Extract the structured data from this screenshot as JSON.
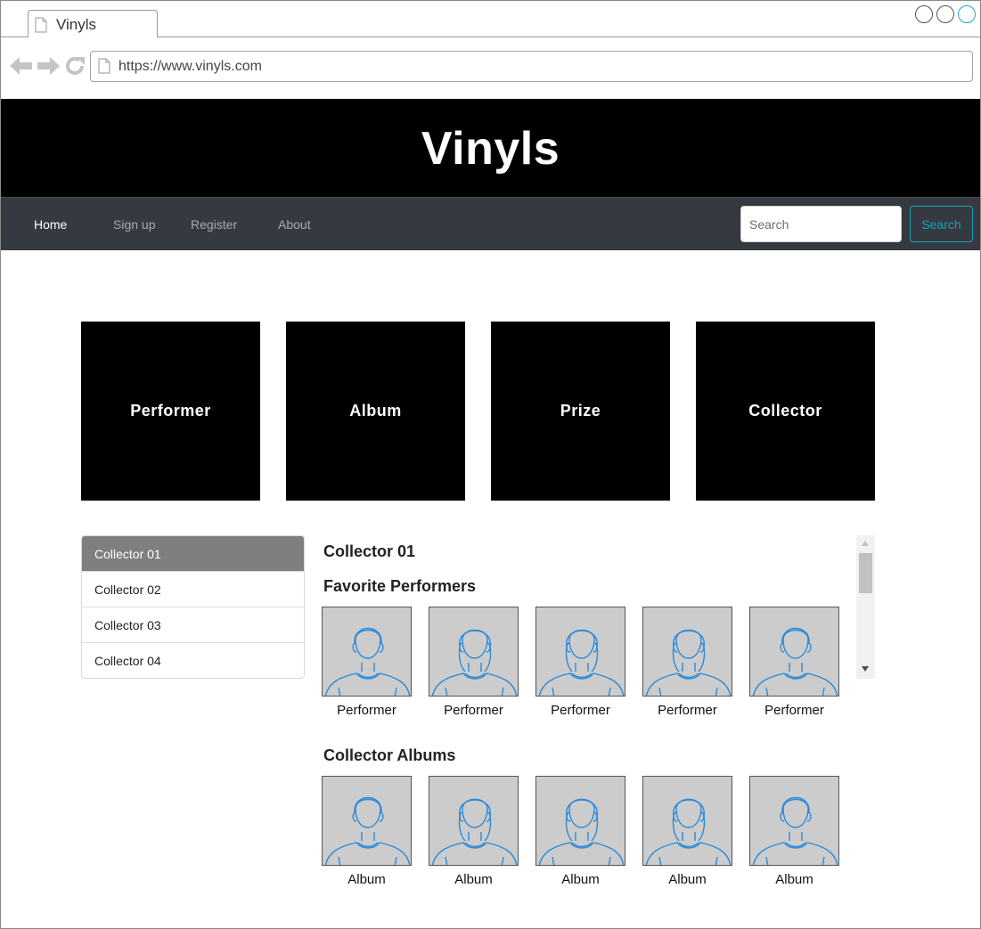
{
  "browser": {
    "tab_title": "Vinyls",
    "url": "https://www.vinyls.com"
  },
  "banner": {
    "title": "Vinyls"
  },
  "navbar": {
    "links": [
      {
        "label": "Home",
        "active": true
      },
      {
        "label": "Sign up",
        "active": false
      },
      {
        "label": "Register",
        "active": false
      },
      {
        "label": "About",
        "active": false
      }
    ],
    "search_placeholder": "Search",
    "search_button": "Search"
  },
  "tiles": [
    "Performer",
    "Album",
    "Prize",
    "Collector"
  ],
  "collectors": [
    {
      "label": "Collector 01",
      "selected": true
    },
    {
      "label": "Collector 02",
      "selected": false
    },
    {
      "label": "Collector 03",
      "selected": false
    },
    {
      "label": "Collector 04",
      "selected": false
    }
  ],
  "detail": {
    "title": "Collector 01",
    "favorite_performers_heading": "Favorite Performers",
    "performers": [
      "Performer",
      "Performer",
      "Performer",
      "Performer",
      "Performer"
    ],
    "albums_heading": "Collector Albums",
    "albums": [
      "Album",
      "Album",
      "Album",
      "Album",
      "Album"
    ]
  },
  "colors": {
    "banner_bg": "#000000",
    "navbar_bg": "#353a41",
    "accent": "#17a2b8",
    "list_selected_bg": "#7f7f7f",
    "avatar_stroke": "#2a8ad8"
  }
}
